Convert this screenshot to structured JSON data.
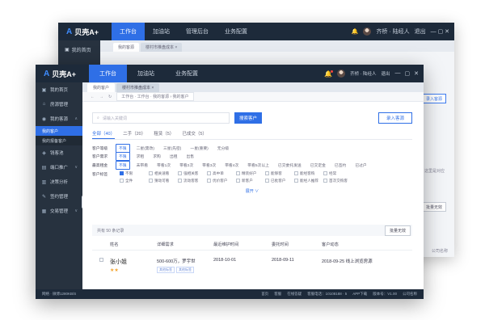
{
  "brand": {
    "name": "贝壳A+"
  },
  "back_window": {
    "nav": [
      "工作台",
      "加油站",
      "管理后台",
      "业务配置"
    ],
    "sidebar_first": "我的首页",
    "tabs": [
      "我的客源",
      "楼村市推盘成本 ×"
    ],
    "address": "我的客户",
    "user": "齐桥 · 陆经人",
    "exit": "退出",
    "right_button": "录入客源",
    "right_note": "这里是对应",
    "right_button2": "批量无效",
    "footer": "公司名称"
  },
  "topbar": {
    "nav": [
      "工作台",
      "加油站",
      "业务配置"
    ],
    "user": "齐桥 · 陆经人",
    "exit": "退出"
  },
  "sidebar": {
    "items": [
      {
        "label": "我的首页",
        "icon": "home-icon"
      },
      {
        "label": "房源管理",
        "icon": "house-icon"
      },
      {
        "label": "我的客源",
        "icon": "user-icon"
      }
    ],
    "sub_items": [
      "我的客户",
      "我的报备客户"
    ],
    "items_after": [
      {
        "label": "钱客池",
        "icon": "pool-icon"
      },
      {
        "label": "端口推广",
        "icon": "port-icon"
      },
      {
        "label": "决策分析",
        "icon": "analysis-icon"
      },
      {
        "label": "签约管理",
        "icon": "contract-icon"
      },
      {
        "label": "交易管理",
        "icon": "trade-icon"
      }
    ],
    "footer": "码城 · 微博1280KB/S"
  },
  "tabs": [
    "我的客户",
    "楼村市推盘成本 ×"
  ],
  "address": {
    "path": "工作台 · 工作台 · 我的客源",
    "current": "我的客户"
  },
  "search": {
    "placeholder": "请输入关键词",
    "button": "搜索客户",
    "enter_button": "录入客源"
  },
  "status_tabs": [
    {
      "label": "全部（40）",
      "active": true
    },
    {
      "label": "二手（20）",
      "active": false
    },
    {
      "label": "租赁（5）",
      "active": false
    },
    {
      "label": "已成交（5）",
      "active": false
    }
  ],
  "filters": [
    {
      "label": "客户等级",
      "options": [
        "不限",
        "二星(需改)",
        "三星(先密)",
        "一星(重要)",
        "无分级"
      ],
      "selected": 0
    },
    {
      "label": "客户需求",
      "options": [
        "不限",
        "求租",
        "求购",
        "出租",
        "出售"
      ],
      "selected": 0
    },
    {
      "label": "最高租金",
      "options": [
        "不限",
        "未带看",
        "带看1次",
        "带看2次",
        "带看3次",
        "带看4次",
        "带看5次以上",
        "已交委托发送",
        "已交定金",
        "已签约",
        "已过户"
      ],
      "selected": 0
    }
  ],
  "tag_filter": {
    "label": "客户标签",
    "tags": [
      "不限",
      "相关速看",
      "强相关客",
      "高中单",
      "精装好户",
      "能够客",
      "能经客购",
      "经常",
      "",
      "全件",
      "猜动可看",
      "流动客客",
      "优价客户",
      "新客户",
      "已批客户",
      "能经人推荐",
      "首次交购客",
      ""
    ],
    "checked": [
      0
    ],
    "expand": "展开 ∨"
  },
  "list_summary": {
    "text": "共有 50 条记录",
    "bulk_button": "批量无效"
  },
  "table": {
    "headers": [
      "",
      "姓名",
      "详细需求",
      "最近维护时间",
      "委托时间",
      "客户动态"
    ],
    "rows": [
      {
        "name": "张小姐",
        "stars": "★★",
        "need": "500-600万，罗宇世",
        "need_tags": [
          "其他标签",
          "其他标签"
        ],
        "last_maintain": "2018-10-01",
        "commission_time": "2018-09-11",
        "dynamic": "2018-09-25 线上浏览房源"
      }
    ]
  },
  "status_bar": {
    "left": "网络 · 微博1280KB/S",
    "items": [
      "首页",
      "客服",
      "在线答疑",
      "客服电话：10108188 · 5",
      "APP下载",
      "版本号：V1.00",
      "公司名称"
    ]
  },
  "colors": {
    "primary": "#2f6fe6",
    "nav_bg": "#1d2a3a",
    "sidebar_bg": "#27323f",
    "star": "#f3a531"
  }
}
